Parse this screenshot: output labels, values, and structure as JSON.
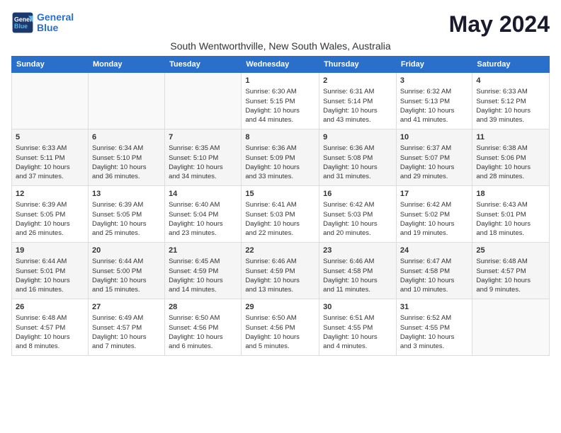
{
  "logo": {
    "line1": "General",
    "line2": "Blue"
  },
  "title": "May 2024",
  "subtitle": "South Wentworthville, New South Wales, Australia",
  "days_of_week": [
    "Sunday",
    "Monday",
    "Tuesday",
    "Wednesday",
    "Thursday",
    "Friday",
    "Saturday"
  ],
  "weeks": [
    [
      {
        "day": "",
        "info": ""
      },
      {
        "day": "",
        "info": ""
      },
      {
        "day": "",
        "info": ""
      },
      {
        "day": "1",
        "info": "Sunrise: 6:30 AM\nSunset: 5:15 PM\nDaylight: 10 hours\nand 44 minutes."
      },
      {
        "day": "2",
        "info": "Sunrise: 6:31 AM\nSunset: 5:14 PM\nDaylight: 10 hours\nand 43 minutes."
      },
      {
        "day": "3",
        "info": "Sunrise: 6:32 AM\nSunset: 5:13 PM\nDaylight: 10 hours\nand 41 minutes."
      },
      {
        "day": "4",
        "info": "Sunrise: 6:33 AM\nSunset: 5:12 PM\nDaylight: 10 hours\nand 39 minutes."
      }
    ],
    [
      {
        "day": "5",
        "info": "Sunrise: 6:33 AM\nSunset: 5:11 PM\nDaylight: 10 hours\nand 37 minutes."
      },
      {
        "day": "6",
        "info": "Sunrise: 6:34 AM\nSunset: 5:10 PM\nDaylight: 10 hours\nand 36 minutes."
      },
      {
        "day": "7",
        "info": "Sunrise: 6:35 AM\nSunset: 5:10 PM\nDaylight: 10 hours\nand 34 minutes."
      },
      {
        "day": "8",
        "info": "Sunrise: 6:36 AM\nSunset: 5:09 PM\nDaylight: 10 hours\nand 33 minutes."
      },
      {
        "day": "9",
        "info": "Sunrise: 6:36 AM\nSunset: 5:08 PM\nDaylight: 10 hours\nand 31 minutes."
      },
      {
        "day": "10",
        "info": "Sunrise: 6:37 AM\nSunset: 5:07 PM\nDaylight: 10 hours\nand 29 minutes."
      },
      {
        "day": "11",
        "info": "Sunrise: 6:38 AM\nSunset: 5:06 PM\nDaylight: 10 hours\nand 28 minutes."
      }
    ],
    [
      {
        "day": "12",
        "info": "Sunrise: 6:39 AM\nSunset: 5:05 PM\nDaylight: 10 hours\nand 26 minutes."
      },
      {
        "day": "13",
        "info": "Sunrise: 6:39 AM\nSunset: 5:05 PM\nDaylight: 10 hours\nand 25 minutes."
      },
      {
        "day": "14",
        "info": "Sunrise: 6:40 AM\nSunset: 5:04 PM\nDaylight: 10 hours\nand 23 minutes."
      },
      {
        "day": "15",
        "info": "Sunrise: 6:41 AM\nSunset: 5:03 PM\nDaylight: 10 hours\nand 22 minutes."
      },
      {
        "day": "16",
        "info": "Sunrise: 6:42 AM\nSunset: 5:03 PM\nDaylight: 10 hours\nand 20 minutes."
      },
      {
        "day": "17",
        "info": "Sunrise: 6:42 AM\nSunset: 5:02 PM\nDaylight: 10 hours\nand 19 minutes."
      },
      {
        "day": "18",
        "info": "Sunrise: 6:43 AM\nSunset: 5:01 PM\nDaylight: 10 hours\nand 18 minutes."
      }
    ],
    [
      {
        "day": "19",
        "info": "Sunrise: 6:44 AM\nSunset: 5:01 PM\nDaylight: 10 hours\nand 16 minutes."
      },
      {
        "day": "20",
        "info": "Sunrise: 6:44 AM\nSunset: 5:00 PM\nDaylight: 10 hours\nand 15 minutes."
      },
      {
        "day": "21",
        "info": "Sunrise: 6:45 AM\nSunset: 4:59 PM\nDaylight: 10 hours\nand 14 minutes."
      },
      {
        "day": "22",
        "info": "Sunrise: 6:46 AM\nSunset: 4:59 PM\nDaylight: 10 hours\nand 13 minutes."
      },
      {
        "day": "23",
        "info": "Sunrise: 6:46 AM\nSunset: 4:58 PM\nDaylight: 10 hours\nand 11 minutes."
      },
      {
        "day": "24",
        "info": "Sunrise: 6:47 AM\nSunset: 4:58 PM\nDaylight: 10 hours\nand 10 minutes."
      },
      {
        "day": "25",
        "info": "Sunrise: 6:48 AM\nSunset: 4:57 PM\nDaylight: 10 hours\nand 9 minutes."
      }
    ],
    [
      {
        "day": "26",
        "info": "Sunrise: 6:48 AM\nSunset: 4:57 PM\nDaylight: 10 hours\nand 8 minutes."
      },
      {
        "day": "27",
        "info": "Sunrise: 6:49 AM\nSunset: 4:57 PM\nDaylight: 10 hours\nand 7 minutes."
      },
      {
        "day": "28",
        "info": "Sunrise: 6:50 AM\nSunset: 4:56 PM\nDaylight: 10 hours\nand 6 minutes."
      },
      {
        "day": "29",
        "info": "Sunrise: 6:50 AM\nSunset: 4:56 PM\nDaylight: 10 hours\nand 5 minutes."
      },
      {
        "day": "30",
        "info": "Sunrise: 6:51 AM\nSunset: 4:55 PM\nDaylight: 10 hours\nand 4 minutes."
      },
      {
        "day": "31",
        "info": "Sunrise: 6:52 AM\nSunset: 4:55 PM\nDaylight: 10 hours\nand 3 minutes."
      },
      {
        "day": "",
        "info": ""
      }
    ]
  ]
}
